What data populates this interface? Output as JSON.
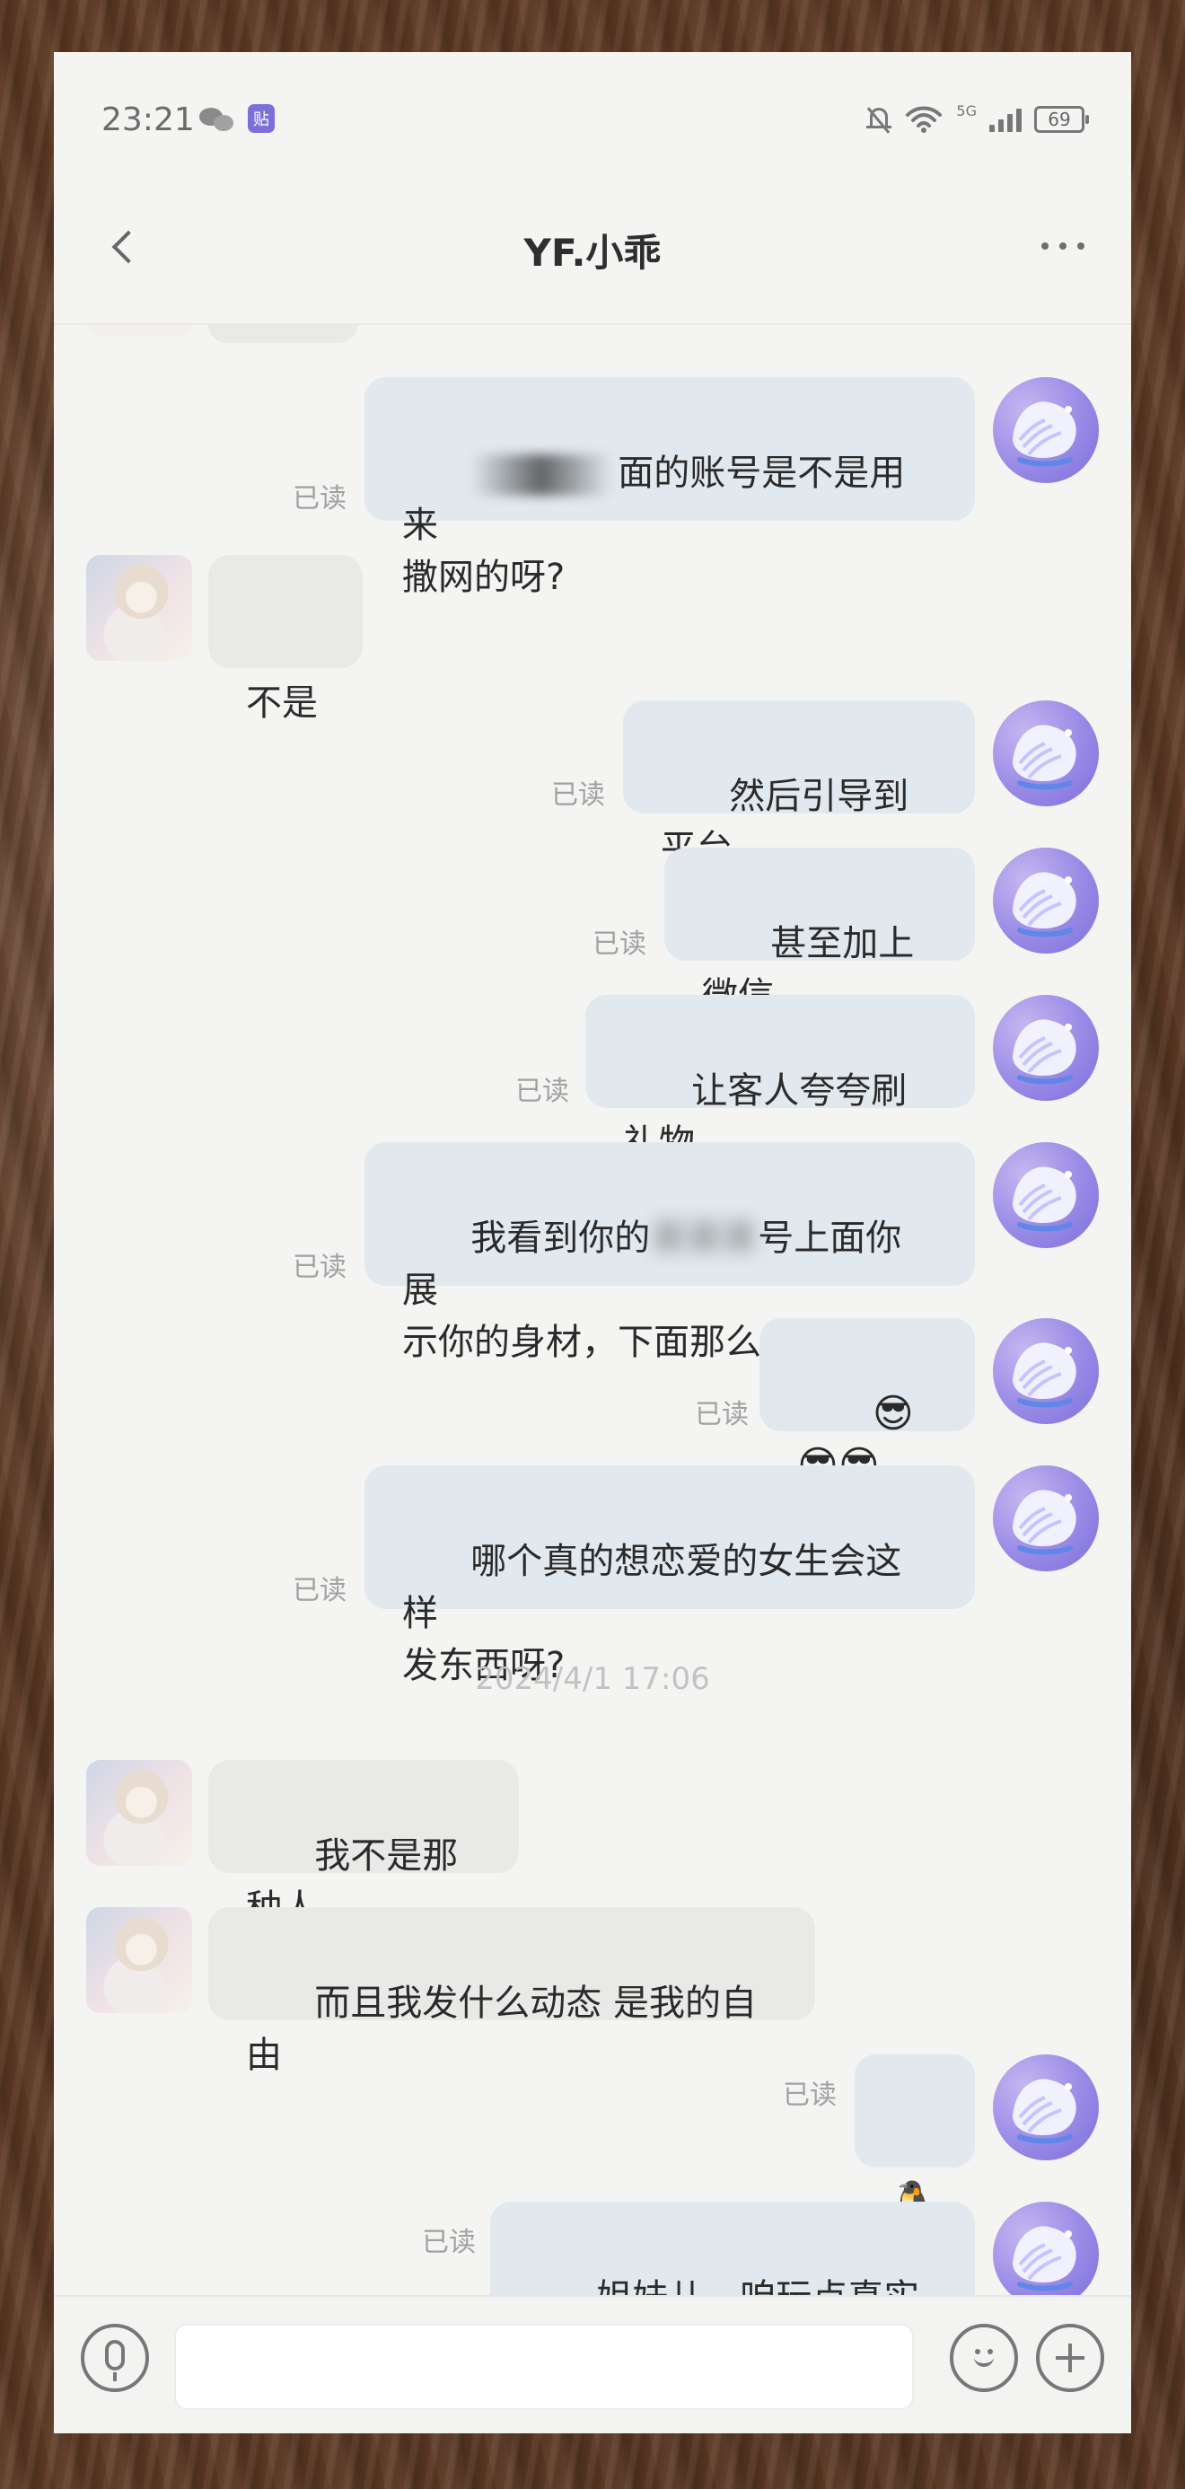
{
  "statusbar": {
    "time": "23:21",
    "sticker_badge": "贴",
    "network": "5G",
    "battery": "69"
  },
  "header": {
    "title": "YF.小乖"
  },
  "messages": [
    {
      "id": "m1",
      "side": "right",
      "text_visible_right": "面的账号是不是用来\n撒网的呀?",
      "read": "已读"
    },
    {
      "id": "m2",
      "side": "left",
      "text": "不是"
    },
    {
      "id": "m3",
      "side": "right",
      "text": "然后引导到平台",
      "read": "已读"
    },
    {
      "id": "m4",
      "side": "right",
      "text": "甚至加上微信",
      "read": "已读"
    },
    {
      "id": "m5",
      "side": "right",
      "text": "让客人夸夸刷礼物",
      "read": "已读"
    },
    {
      "id": "m6",
      "side": "right",
      "text_a": "我看到你的",
      "text_blur": "某某某",
      "text_b": "号上面你展\n示你的身材，下面那么多留言",
      "read": "已读"
    },
    {
      "id": "m7",
      "side": "right",
      "text": "😎😎😎",
      "read": "已读"
    },
    {
      "id": "m8",
      "side": "right",
      "text": "哪个真的想恋爱的女生会这样\n发东西呀?",
      "read": "已读"
    },
    {
      "id": "ts1",
      "type": "timestamp",
      "text": "2024/4/1 17:06"
    },
    {
      "id": "m9",
      "side": "left",
      "text": "我不是那种人"
    },
    {
      "id": "m10",
      "side": "left",
      "text": "而且我发什么动态 是我的自由"
    },
    {
      "id": "m11",
      "side": "right",
      "text": "🐧",
      "read": "已读"
    },
    {
      "id": "m12",
      "side": "right",
      "text": "姐妹儿，咱玩点真实的吧",
      "read": "已读"
    }
  ],
  "input": {
    "placeholder": ""
  },
  "icons": {
    "back": "back-icon",
    "more": "more-icon",
    "mic": "microphone-icon",
    "emoji": "emoji-icon",
    "plus": "plus-icon",
    "avatar_right": "shell-avatar-icon"
  },
  "colors": {
    "screen_bg": "#f4f4f2",
    "incoming_bubble": "#e9e9e7",
    "outgoing_bubble": "#e2e9ee",
    "read_text": "#a1a1a1",
    "timestamp_text": "#c2c2c2",
    "avatar_purple": "#9a8ae6"
  }
}
